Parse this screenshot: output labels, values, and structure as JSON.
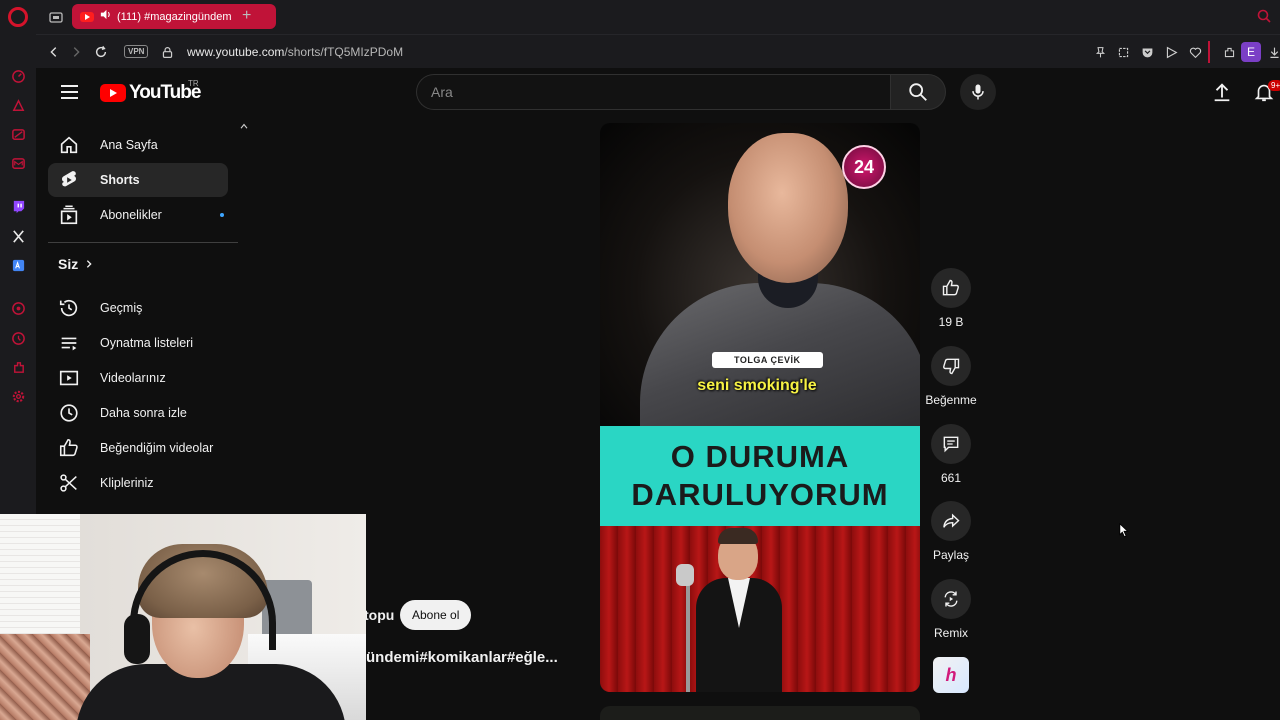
{
  "browser": {
    "tab_title": "(111) #magazingündem",
    "new_tab_symbol": "+",
    "vpn_label": "VPN",
    "url_host": "www.youtube.com",
    "url_path": "/shorts/fTQ5MIzPDoM",
    "profile_letter": "E",
    "accent_color": "#c01338"
  },
  "header": {
    "logo_text": "YouTube",
    "region": "TR",
    "search_placeholder": "Ara",
    "notification_badge": "9+"
  },
  "guide": {
    "items": [
      {
        "label": "Ana Sayfa",
        "icon": "home-icon"
      },
      {
        "label": "Shorts",
        "icon": "shorts-icon"
      },
      {
        "label": "Abonelikler",
        "icon": "subscriptions-icon"
      }
    ],
    "you_label": "Siz",
    "you_items": [
      {
        "label": "Geçmiş",
        "icon": "history-icon"
      },
      {
        "label": "Oynatma listeleri",
        "icon": "playlists-icon"
      },
      {
        "label": "Videolarınız",
        "icon": "your-videos-icon"
      },
      {
        "label": "Daha sonra izle",
        "icon": "watch-later-icon"
      },
      {
        "label": "Beğendiğim videolar",
        "icon": "liked-videos-icon"
      },
      {
        "label": "Klipleriniz",
        "icon": "clips-icon"
      }
    ]
  },
  "short": {
    "badge_text": "24",
    "name_pill": "TOLGA ÇEVİK",
    "caption": "seni smoking'le",
    "title_line1": "O DURUMA",
    "title_line2": "DARULUYORUM",
    "channel_partial": "topu",
    "subscribe_label": "Abone ol",
    "title_partial": "ündemi#komikanlar#eğle..."
  },
  "actions": {
    "like_count": "19 B",
    "dislike_label": "Beğenme",
    "comment_count": "661",
    "share_label": "Paylaş",
    "remix_label": "Remix"
  }
}
